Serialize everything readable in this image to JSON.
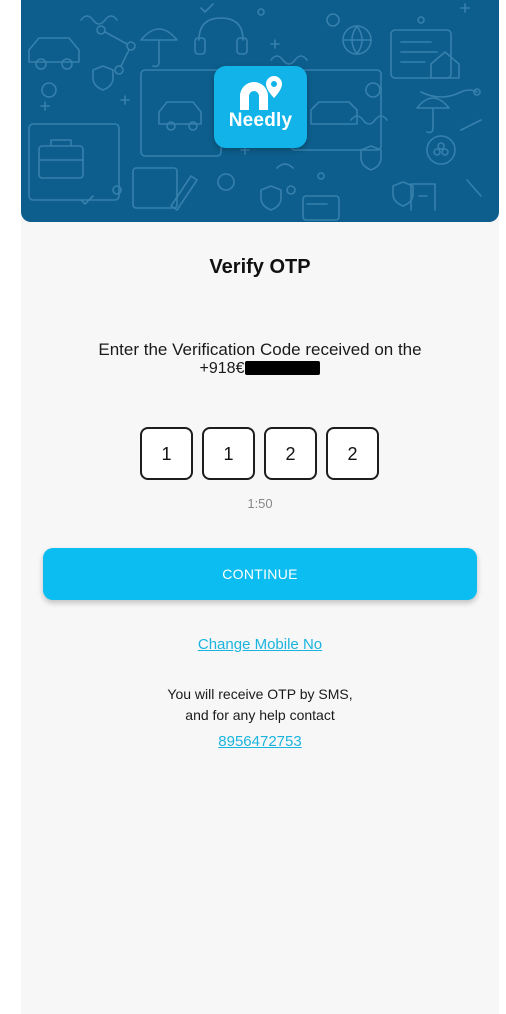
{
  "banner": {
    "brand_name": "Needly",
    "background_color": "#0d5e8c",
    "logo_color": "#12b3e8"
  },
  "verify": {
    "title": "Verify OTP",
    "instruction": "Enter the Verification Code received on the",
    "phone_prefix": "+918€"
  },
  "otp": {
    "digits": [
      "1",
      "1",
      "2",
      "2"
    ],
    "timer": "1:50"
  },
  "actions": {
    "continue_label": "CONTINUE",
    "continue_color": "#0bbdf0",
    "change_mobile_label": "Change Mobile No"
  },
  "help": {
    "line1": "You will receive OTP by SMS,",
    "line2": "and for any help contact",
    "contact_number": "8956472753"
  }
}
